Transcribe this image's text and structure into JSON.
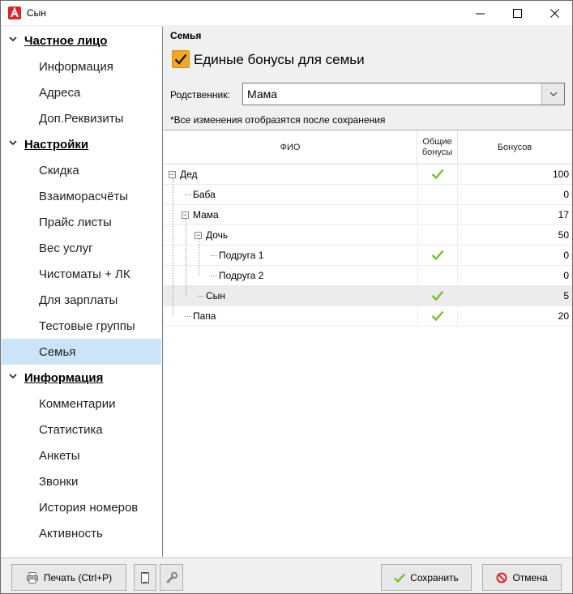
{
  "window": {
    "title": "Сын",
    "minimize": "—",
    "maximize": "☐",
    "close": "✕"
  },
  "sidebar": {
    "groups": [
      {
        "label": "Частное лицо",
        "items": [
          "Информация",
          "Адреса",
          "Доп.Реквизиты"
        ]
      },
      {
        "label": "Настройки",
        "items": [
          "Скидка",
          "Взаиморасчёты",
          "Прайс листы",
          "Вес услуг",
          "Чистоматы + ЛК",
          "Для зарплаты",
          "Тестовые группы",
          "Семья"
        ]
      },
      {
        "label": "Информация",
        "items": [
          "Комментарии",
          "Статистика",
          "Анкеты",
          "Звонки",
          "История номеров",
          "Активность"
        ]
      }
    ],
    "selected": "Семья"
  },
  "main": {
    "section_title": "Семья",
    "family_checkbox": {
      "label": "Единые бонусы для семьи",
      "checked": true
    },
    "relative": {
      "label": "Родственник:",
      "value": "Мама"
    },
    "note": "*Все изменения отобразятся после сохранения"
  },
  "grid": {
    "columns": {
      "fio": "ФИО",
      "shared_line1": "Общие",
      "shared_line2": "бонусы",
      "bonus": "Бонусов"
    },
    "rows": [
      {
        "name": "Дед",
        "level": 0,
        "expander": "−",
        "shared": true,
        "bonus": "100"
      },
      {
        "name": "Баба",
        "level": 1,
        "shared": false,
        "bonus": "0"
      },
      {
        "name": "Мама",
        "level": 1,
        "expander": "−",
        "shared": false,
        "bonus": "17"
      },
      {
        "name": "Дочь",
        "level": 2,
        "expander": "−",
        "shared": false,
        "bonus": "50"
      },
      {
        "name": "Подруга 1",
        "level": 3,
        "shared": true,
        "bonus": "0"
      },
      {
        "name": "Подруга 2",
        "level": 3,
        "shared": false,
        "bonus": "0"
      },
      {
        "name": "Сын",
        "level": 2,
        "shared": true,
        "bonus": "5",
        "selected": true
      },
      {
        "name": "Папа",
        "level": 1,
        "shared": true,
        "bonus": "20"
      }
    ]
  },
  "footer": {
    "print": "Печать (Ctrl+P)",
    "save": "Сохранить",
    "cancel": "Отмена"
  },
  "colors": {
    "accent_check": "#f5a623",
    "selected_nav": "#cce4f7",
    "ok_green": "#7bbf2a",
    "cancel_red": "#d9262a"
  },
  "icons": {
    "app": "app-logo-icon",
    "print": "printer-icon",
    "doc": "document-icon",
    "wrench": "wrench-icon",
    "save": "checkmark-icon",
    "cancel": "prohibited-icon"
  }
}
